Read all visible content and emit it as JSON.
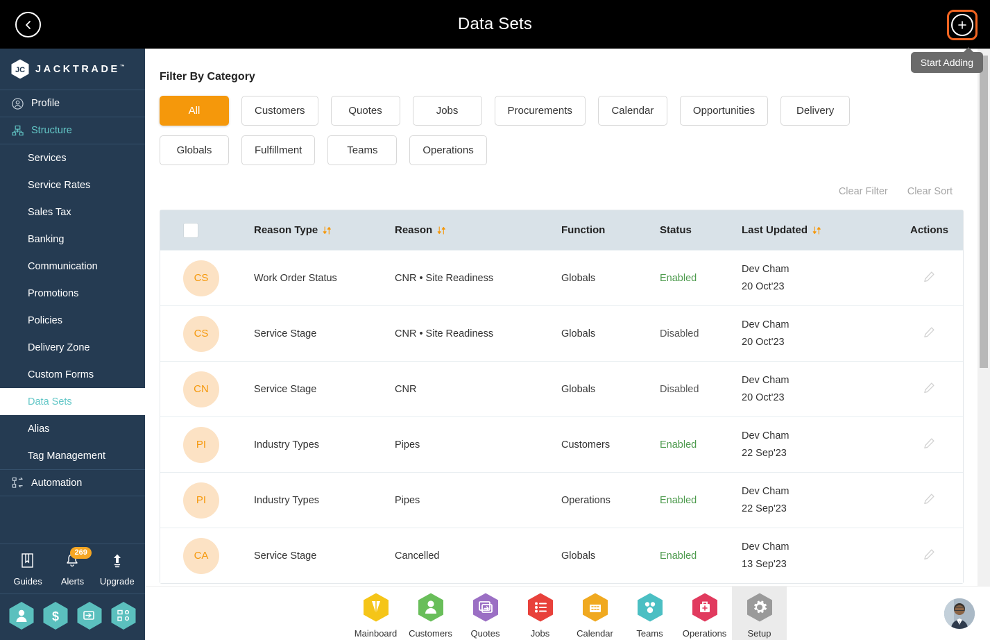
{
  "header": {
    "title": "Data Sets",
    "back_icon": "chevron-left-icon",
    "add_icon": "plus-icon",
    "tooltip": "Start Adding",
    "accent_orange": "#F26522",
    "background": "#000000"
  },
  "sidebar": {
    "brand": "JACKTRADE",
    "brand_tm": "™",
    "background": "#253B52",
    "accent_teal": "#63C7C7",
    "items": [
      {
        "label": "Profile",
        "icon": "user-circle-icon",
        "level": "top",
        "state": "normal"
      },
      {
        "label": "Structure",
        "icon": "sitemap-icon",
        "level": "top",
        "state": "accent"
      },
      {
        "label": "Services",
        "icon": "",
        "level": "sub",
        "state": "normal"
      },
      {
        "label": "Service Rates",
        "icon": "",
        "level": "sub",
        "state": "normal"
      },
      {
        "label": "Sales Tax",
        "icon": "",
        "level": "sub",
        "state": "normal"
      },
      {
        "label": "Banking",
        "icon": "",
        "level": "sub",
        "state": "normal"
      },
      {
        "label": "Communication",
        "icon": "",
        "level": "sub",
        "state": "normal"
      },
      {
        "label": "Promotions",
        "icon": "",
        "level": "sub",
        "state": "normal"
      },
      {
        "label": "Policies",
        "icon": "",
        "level": "sub",
        "state": "normal"
      },
      {
        "label": "Delivery Zone",
        "icon": "",
        "level": "sub",
        "state": "normal"
      },
      {
        "label": "Custom Forms",
        "icon": "",
        "level": "sub",
        "state": "normal"
      },
      {
        "label": "Data Sets",
        "icon": "",
        "level": "sub",
        "state": "active"
      },
      {
        "label": "Alias",
        "icon": "",
        "level": "sub",
        "state": "normal"
      },
      {
        "label": "Tag Management",
        "icon": "",
        "level": "sub",
        "state": "normal"
      },
      {
        "label": "Automation",
        "icon": "automation-icon",
        "level": "top",
        "state": "normal"
      }
    ],
    "utilities": [
      {
        "label": "Guides",
        "icon": "book-icon",
        "badge": ""
      },
      {
        "label": "Alerts",
        "icon": "bell-icon",
        "badge": "269"
      },
      {
        "label": "Upgrade",
        "icon": "up-arrow-icon",
        "badge": ""
      }
    ],
    "hex_shortcuts": [
      {
        "icon": "person-hex-icon",
        "color": "#5BC0BE"
      },
      {
        "icon": "dollar-hex-icon",
        "color": "#5BC0BE"
      },
      {
        "icon": "quote-hex-icon",
        "color": "#5BC0BE"
      },
      {
        "icon": "workflow-hex-icon",
        "color": "#5BC0BE"
      }
    ],
    "badge_color": "#F5A623"
  },
  "filter": {
    "heading": "Filter By Category",
    "selected": "All",
    "selected_color": "#F5980B",
    "chips": [
      "All",
      "Customers",
      "Quotes",
      "Jobs",
      "Procurements",
      "Calendar",
      "Opportunities",
      "Delivery",
      "Globals",
      "Fulfillment",
      "Teams",
      "Operations"
    ]
  },
  "actions": {
    "clear_filter": "Clear Filter",
    "clear_sort": "Clear Sort"
  },
  "table": {
    "header_bg": "#d9e2e8",
    "columns": [
      {
        "label": "",
        "sortable": false,
        "key": "select"
      },
      {
        "label": "Reason Type",
        "sortable": true,
        "key": "reason_type"
      },
      {
        "label": "Reason",
        "sortable": true,
        "key": "reason"
      },
      {
        "label": "Function",
        "sortable": false,
        "key": "function"
      },
      {
        "label": "Status",
        "sortable": false,
        "key": "status"
      },
      {
        "label": "Last Updated",
        "sortable": true,
        "key": "last_updated"
      },
      {
        "label": "Actions",
        "sortable": false,
        "key": "actions"
      }
    ],
    "rows": [
      {
        "initials": "CS",
        "reason_type": "Work Order Status",
        "reason": "CNR • Site Readiness",
        "function": "Globals",
        "status": "Enabled",
        "updated_by": "Dev Cham",
        "updated_on": "20 Oct'23",
        "action_icon": "pencil-icon"
      },
      {
        "initials": "CS",
        "reason_type": "Service Stage",
        "reason": "CNR • Site Readiness",
        "function": "Globals",
        "status": "Disabled",
        "updated_by": "Dev Cham",
        "updated_on": "20 Oct'23",
        "action_icon": "pencil-icon"
      },
      {
        "initials": "CN",
        "reason_type": "Service Stage",
        "reason": "CNR",
        "function": "Globals",
        "status": "Disabled",
        "updated_by": "Dev Cham",
        "updated_on": "20 Oct'23",
        "action_icon": "pencil-icon"
      },
      {
        "initials": "PI",
        "reason_type": "Industry Types",
        "reason": "Pipes",
        "function": "Customers",
        "status": "Enabled",
        "updated_by": "Dev Cham",
        "updated_on": "22 Sep'23",
        "action_icon": "pencil-icon"
      },
      {
        "initials": "PI",
        "reason_type": "Industry Types",
        "reason": "Pipes",
        "function": "Operations",
        "status": "Enabled",
        "updated_by": "Dev Cham",
        "updated_on": "22 Sep'23",
        "action_icon": "pencil-icon"
      },
      {
        "initials": "CA",
        "reason_type": "Service Stage",
        "reason": "Cancelled",
        "function": "Globals",
        "status": "Enabled",
        "updated_by": "Dev Cham",
        "updated_on": "13 Sep'23",
        "action_icon": "pencil-icon"
      }
    ],
    "status_enabled_color": "#4C9A4C",
    "avatar_bg": "#FCE2C4",
    "avatar_fg": "#F5980B",
    "sort_icon_color": "#F5980B"
  },
  "dock": {
    "active": "Setup",
    "items": [
      {
        "label": "Mainboard",
        "icon": "mainboard-hex-icon",
        "color": "#F5C518"
      },
      {
        "label": "Customers",
        "icon": "customers-hex-icon",
        "color": "#69BE5A"
      },
      {
        "label": "Quotes",
        "icon": "quotes-hex-icon",
        "color": "#9B6FC4"
      },
      {
        "label": "Jobs",
        "icon": "jobs-hex-icon",
        "color": "#E8413B"
      },
      {
        "label": "Calendar",
        "icon": "calendar-hex-icon",
        "color": "#F0A920"
      },
      {
        "label": "Teams",
        "icon": "teams-hex-icon",
        "color": "#4BBFC3"
      },
      {
        "label": "Operations",
        "icon": "operations-hex-icon",
        "color": "#E13A5E"
      },
      {
        "label": "Setup",
        "icon": "setup-hex-icon",
        "color": "#9A9A9A"
      }
    ],
    "avatar": "user-photo-avatar"
  }
}
